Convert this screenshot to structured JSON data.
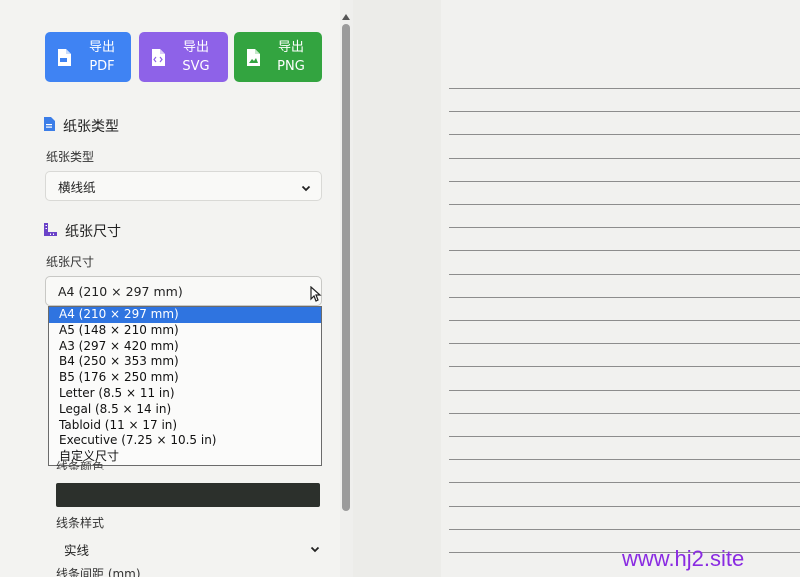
{
  "toolbar": {
    "export_pdf": {
      "line1": "导出",
      "line2": "PDF"
    },
    "export_svg": {
      "line1": "导出",
      "line2": "SVG"
    },
    "export_png": {
      "line1": "导出",
      "line2": "PNG"
    }
  },
  "paper_type_section": {
    "title": "纸张类型",
    "label": "纸张类型",
    "selected": "横线纸"
  },
  "paper_size_section": {
    "title": "纸张尺寸",
    "label": "纸张尺寸",
    "selected": "A4 (210 × 297 mm)",
    "options": [
      "A4 (210 × 297 mm)",
      "A5 (148 × 210 mm)",
      "A3 (297 × 420 mm)",
      "B4 (250 × 353 mm)",
      "B5 (176 × 250 mm)",
      "Letter (8.5 × 11 in)",
      "Legal (8.5 × 14 in)",
      "Tabloid (11 × 17 in)",
      "Executive (7.25 × 10.5 in)",
      "自定义尺寸"
    ]
  },
  "line_settings": {
    "color_label_partial": "线条颜色",
    "line_color": "#2c302c",
    "style_label": "线条样式",
    "style_selected": "实线",
    "spacing_label": "线条间距 (mm)"
  },
  "watermark": "www.hj2.site",
  "colors": {
    "pdf": "#3f83f3",
    "svg": "#8e62e8",
    "png": "#33a440",
    "selection": "#2f74e0"
  }
}
